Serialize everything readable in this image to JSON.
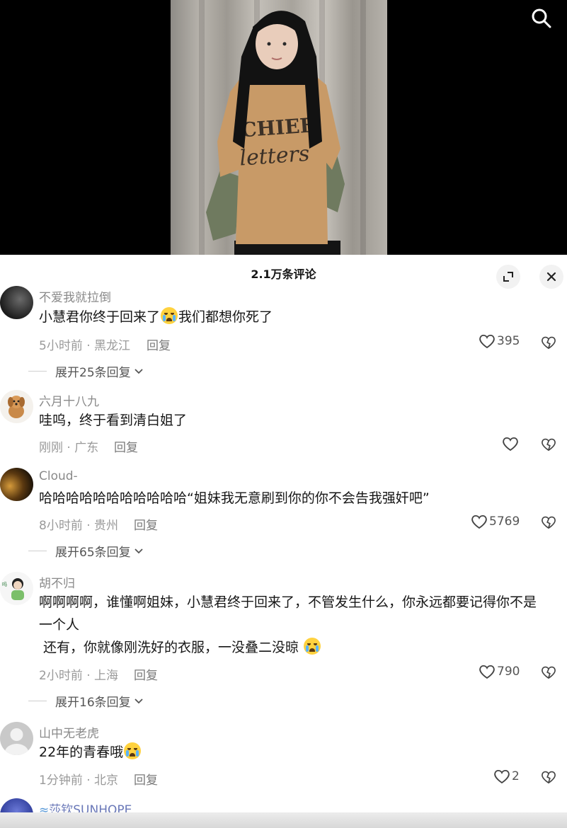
{
  "video": {
    "search_icon": "search-icon"
  },
  "sheet": {
    "title": "2.1万条评论",
    "expand_icon": "fullscreen-icon",
    "close_icon": "close-icon"
  },
  "comments": [
    {
      "username": "不爱我就拉倒",
      "text_before": "小慧君你终于回来了",
      "text_after": "我们都想你死了",
      "emoji": "crying-face",
      "time": "5小时前",
      "location": "黑龙江",
      "reply_label": "回复",
      "likes": "395",
      "expand_label": "展开25条回复"
    },
    {
      "username": "六月十八九",
      "text": "哇呜，终于看到清白姐了",
      "time": "刚刚",
      "location": "广东",
      "reply_label": "回复",
      "likes": ""
    },
    {
      "username": "Cloud-",
      "text": "哈哈哈哈哈哈哈哈哈哈哈“姐妹我无意刷到你的你不会告我强奸吧”",
      "time": "8小时前",
      "location": "贵州",
      "reply_label": "回复",
      "likes": "5769",
      "expand_label": "展开65条回复"
    },
    {
      "username": "胡不归",
      "text_line1": "啊啊啊啊，谁懂啊姐妹，小慧君终于回来了，不管发生什么，你永远都要记得你不是",
      "text_line2": "一个人",
      "text_line3": " 还有，你就像刚洗好的衣服，一没叠二没晾",
      "emoji": "crying-face",
      "time": "2小时前",
      "location": "上海",
      "reply_label": "回复",
      "likes": "790",
      "expand_label": "展开16条回复"
    },
    {
      "username": "山中无老虎",
      "text": "22年的青春哦",
      "emoji": "crying-face",
      "time": "1分钟前",
      "location": "北京",
      "reply_label": "回复",
      "likes": "2"
    },
    {
      "username": "莎钦SUNHOPE"
    }
  ],
  "meta_separator": " · ",
  "colors": {
    "sheet_bg": "#ffffff",
    "video_bg": "#000000",
    "muted_text": "#8a8a8a"
  }
}
